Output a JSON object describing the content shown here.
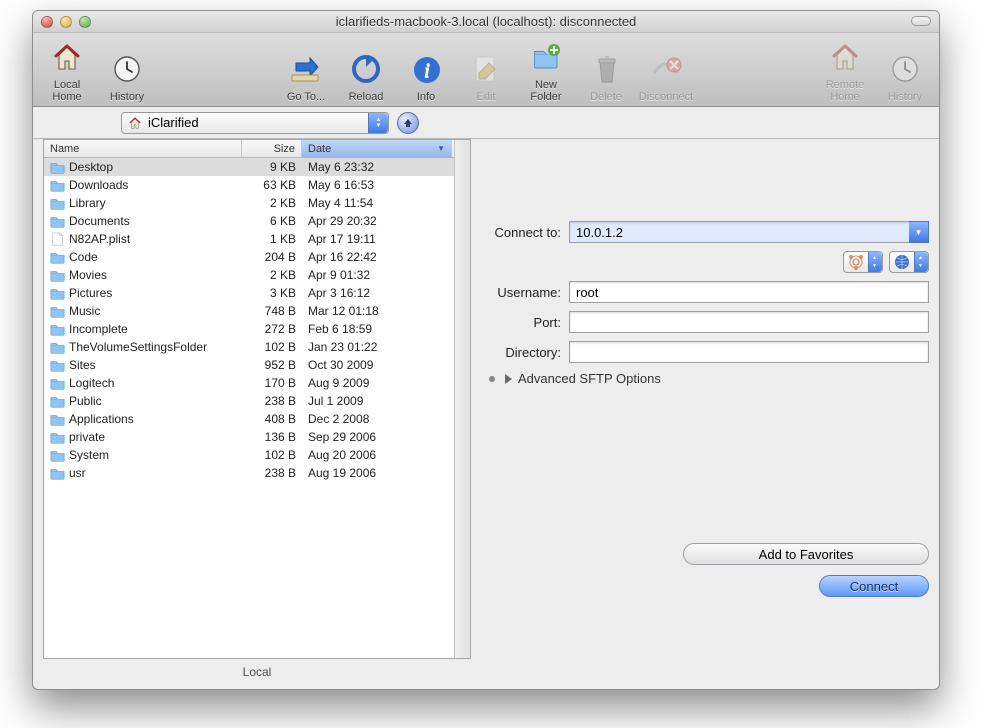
{
  "window": {
    "title": "iclarifieds-macbook-3.local (localhost): disconnected"
  },
  "toolbar": {
    "local_home": "Local Home",
    "local_hist": "History",
    "goto": "Go To...",
    "reload": "Reload",
    "info": "Info",
    "edit": "Edit",
    "new_folder": "New Folder",
    "delete": "Delete",
    "disconnect": "Disconnect",
    "remote_home": "Remote Home",
    "remote_hist": "History"
  },
  "path_popup": {
    "label": "iClarified"
  },
  "columns": {
    "name": "Name",
    "size": "Size",
    "date": "Date"
  },
  "files": [
    {
      "icon": "folder",
      "name": "Desktop",
      "size": "9 KB",
      "date": "May 6 23:32",
      "selected": true
    },
    {
      "icon": "folder",
      "name": "Downloads",
      "size": "63 KB",
      "date": "May 6 16:53"
    },
    {
      "icon": "folder",
      "name": "Library",
      "size": "2 KB",
      "date": "May 4 11:54"
    },
    {
      "icon": "folder",
      "name": "Documents",
      "size": "6 KB",
      "date": "Apr 29 20:32"
    },
    {
      "icon": "file",
      "name": "N82AP.plist",
      "size": "1 KB",
      "date": "Apr 17 19:11"
    },
    {
      "icon": "folder",
      "name": "Code",
      "size": "204 B",
      "date": "Apr 16 22:42"
    },
    {
      "icon": "folder",
      "name": "Movies",
      "size": "2 KB",
      "date": "Apr 9 01:32"
    },
    {
      "icon": "folder",
      "name": "Pictures",
      "size": "3 KB",
      "date": "Apr 3 16:12"
    },
    {
      "icon": "folder",
      "name": "Music",
      "size": "748 B",
      "date": "Mar 12 01:18"
    },
    {
      "icon": "folder",
      "name": "Incomplete",
      "size": "272 B",
      "date": "Feb 6 18:59"
    },
    {
      "icon": "folder",
      "name": "TheVolumeSettingsFolder",
      "size": "102 B",
      "date": "Jan 23 01:22"
    },
    {
      "icon": "folder",
      "name": "Sites",
      "size": "952 B",
      "date": "Oct 30 2009"
    },
    {
      "icon": "folder",
      "name": "Logitech",
      "size": "170 B",
      "date": "Aug 9 2009"
    },
    {
      "icon": "folder",
      "name": "Public",
      "size": "238 B",
      "date": "Jul 1 2009"
    },
    {
      "icon": "folder",
      "name": "Applications",
      "size": "408 B",
      "date": "Dec 2 2008"
    },
    {
      "icon": "folder",
      "name": "private",
      "size": "136 B",
      "date": "Sep 29 2006"
    },
    {
      "icon": "folder",
      "name": "System",
      "size": "102 B",
      "date": "Aug 20 2006"
    },
    {
      "icon": "folder",
      "name": "usr",
      "size": "238 B",
      "date": "Aug 19 2006"
    }
  ],
  "local_label": "Local",
  "form": {
    "connect_to_label": "Connect to:",
    "connect_to_value": "10.0.1.2",
    "username_label": "Username:",
    "username_value": "root",
    "port_label": "Port:",
    "port_value": "",
    "directory_label": "Directory:",
    "directory_value": "",
    "advanced_label": "Advanced SFTP Options"
  },
  "buttons": {
    "favorites": "Add to Favorites",
    "connect": "Connect"
  }
}
